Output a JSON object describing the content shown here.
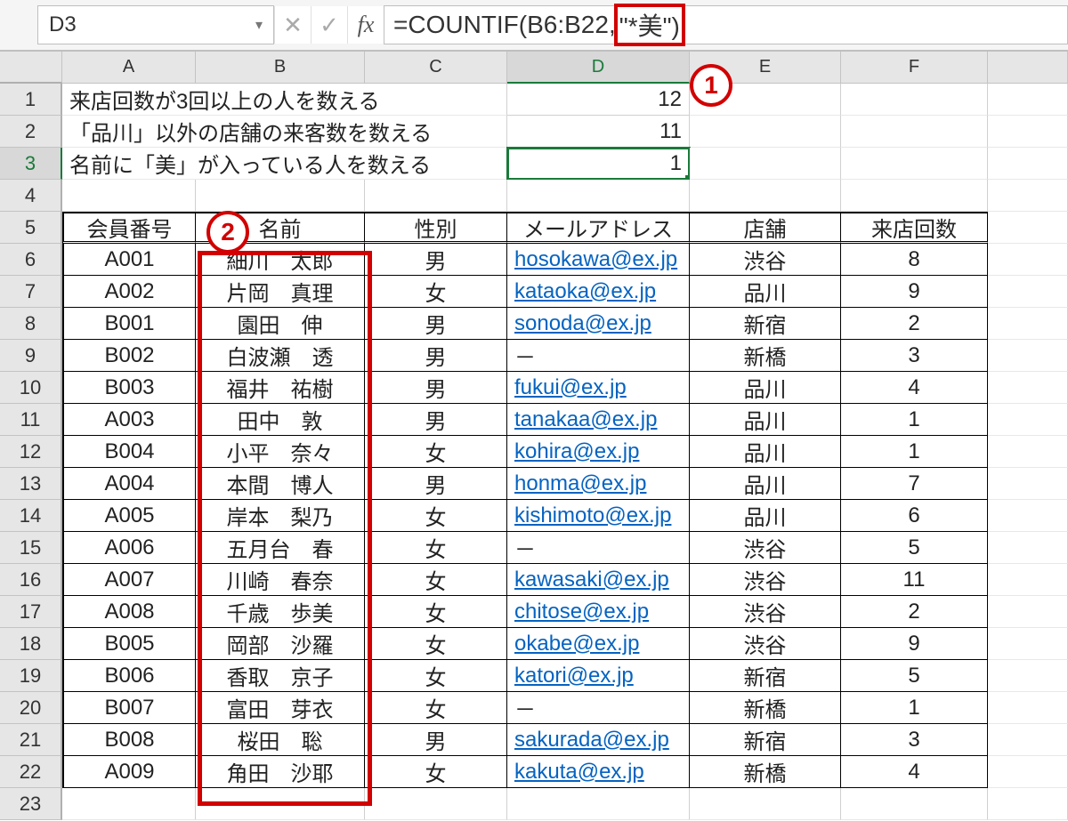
{
  "name_box": {
    "value": "D3",
    "dropdown_glyph": "▾"
  },
  "formula_bar": {
    "cancel_glyph": "✕",
    "enter_glyph": "✓",
    "fx_label": "fx",
    "formula_pre": "=COUNTIF(B6:B22,",
    "formula_hi": "\"*美\")"
  },
  "columns": [
    "A",
    "B",
    "C",
    "D",
    "E",
    "F"
  ],
  "text_rows": [
    {
      "row": 1,
      "label": "来店回数が3回以上の人を数える",
      "value": "12"
    },
    {
      "row": 2,
      "label": "「品川」以外の店舗の来客数を数える",
      "value": "11"
    },
    {
      "row": 3,
      "label": "名前に「美」が入っている人を数える",
      "value": "1"
    }
  ],
  "table": {
    "headers": [
      "会員番号",
      "名前",
      "性別",
      "メールアドレス",
      "店舗",
      "来店回数"
    ],
    "rows": [
      {
        "id": "A001",
        "name": "細川　太郎",
        "sex": "男",
        "mail": "hosokawa@ex.jp",
        "store": "渋谷",
        "cnt": "8"
      },
      {
        "id": "A002",
        "name": "片岡　真理",
        "sex": "女",
        "mail": "kataoka@ex.jp",
        "store": "品川",
        "cnt": "9"
      },
      {
        "id": "B001",
        "name": "園田　伸",
        "sex": "男",
        "mail": "sonoda@ex.jp",
        "store": "新宿",
        "cnt": "2"
      },
      {
        "id": "B002",
        "name": "白波瀬　透",
        "sex": "男",
        "mail": "－",
        "store": "新橋",
        "cnt": "3"
      },
      {
        "id": "B003",
        "name": "福井　祐樹",
        "sex": "男",
        "mail": "fukui@ex.jp",
        "store": "品川",
        "cnt": "4"
      },
      {
        "id": "A003",
        "name": "田中　敦",
        "sex": "男",
        "mail": "tanakaa@ex.jp",
        "store": "品川",
        "cnt": "1"
      },
      {
        "id": "B004",
        "name": "小平　奈々",
        "sex": "女",
        "mail": "kohira@ex.jp",
        "store": "品川",
        "cnt": "1"
      },
      {
        "id": "A004",
        "name": "本間　博人",
        "sex": "男",
        "mail": "honma@ex.jp",
        "store": "品川",
        "cnt": "7"
      },
      {
        "id": "A005",
        "name": "岸本　梨乃",
        "sex": "女",
        "mail": "kishimoto@ex.jp",
        "store": "品川",
        "cnt": "6"
      },
      {
        "id": "A006",
        "name": "五月台　春",
        "sex": "女",
        "mail": "－",
        "store": "渋谷",
        "cnt": "5"
      },
      {
        "id": "A007",
        "name": "川崎　春奈",
        "sex": "女",
        "mail": "kawasaki@ex.jp",
        "store": "渋谷",
        "cnt": "11"
      },
      {
        "id": "A008",
        "name": "千歳　歩美",
        "sex": "女",
        "mail": "chitose@ex.jp",
        "store": "渋谷",
        "cnt": "2"
      },
      {
        "id": "B005",
        "name": "岡部　沙羅",
        "sex": "女",
        "mail": "okabe@ex.jp",
        "store": "渋谷",
        "cnt": "9"
      },
      {
        "id": "B006",
        "name": "香取　京子",
        "sex": "女",
        "mail": "katori@ex.jp",
        "store": "新宿",
        "cnt": "5"
      },
      {
        "id": "B007",
        "name": "富田　芽衣",
        "sex": "女",
        "mail": "－",
        "store": "新橋",
        "cnt": "1"
      },
      {
        "id": "B008",
        "name": "桜田　聡",
        "sex": "男",
        "mail": "sakurada@ex.jp",
        "store": "新宿",
        "cnt": "3"
      },
      {
        "id": "A009",
        "name": "角田　沙耶",
        "sex": "女",
        "mail": "kakuta@ex.jp",
        "store": "新橋",
        "cnt": "4"
      }
    ]
  },
  "callouts": {
    "one": "1",
    "two": "2"
  }
}
